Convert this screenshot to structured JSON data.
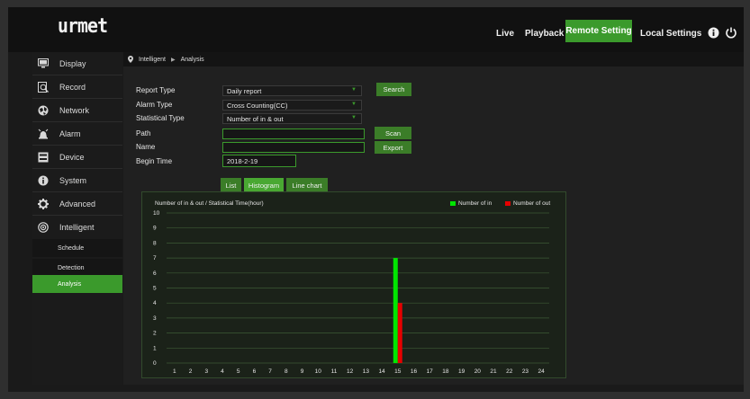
{
  "header": {
    "logo": "urmet",
    "nav": [
      {
        "label": "Live",
        "active": false
      },
      {
        "label": "Playback",
        "active": false
      },
      {
        "label": "Remote Setting",
        "active": true
      },
      {
        "label": "Local Settings",
        "active": false
      }
    ],
    "icons": [
      "info-icon",
      "power-icon"
    ]
  },
  "sidebar": {
    "items": [
      {
        "label": "Display",
        "icon": "monitor-icon"
      },
      {
        "label": "Record",
        "icon": "record-icon"
      },
      {
        "label": "Network",
        "icon": "network-icon"
      },
      {
        "label": "Alarm",
        "icon": "alarm-icon"
      },
      {
        "label": "Device",
        "icon": "device-icon"
      },
      {
        "label": "System",
        "icon": "system-info-icon"
      },
      {
        "label": "Advanced",
        "icon": "gear-icon"
      },
      {
        "label": "Intelligent",
        "icon": "intelligent-icon"
      }
    ],
    "subitems": [
      {
        "label": "Schedule",
        "active": false
      },
      {
        "label": "Detection",
        "active": false
      },
      {
        "label": "Analysis",
        "active": true
      }
    ]
  },
  "breadcrumb": {
    "section": "Intelligent",
    "page": "Analysis"
  },
  "form": {
    "report_type_label": "Report Type",
    "report_type_value": "Daily report",
    "alarm_type_label": "Alarm Type",
    "alarm_type_value": "Cross Counting(CC)",
    "statistical_type_label": "Statistical Type",
    "statistical_type_value": "Number of in & out",
    "path_label": "Path",
    "path_value": "",
    "name_label": "Name",
    "name_value": "",
    "begin_time_label": "Begin Time",
    "begin_time_value": "2018-2-19",
    "search_button": "Search",
    "scan_button": "Scan",
    "export_button": "Export"
  },
  "view_tabs": [
    {
      "label": "List",
      "active": false
    },
    {
      "label": "Histogram",
      "active": true
    },
    {
      "label": "Line chart",
      "active": false
    }
  ],
  "colors": {
    "accent": "#3b9a2c",
    "series_in": "#00e600",
    "series_out": "#e60000"
  },
  "chart_data": {
    "type": "bar",
    "title": "Number of in & out / Statistical Time(hour)",
    "xlabel": "",
    "ylabel": "",
    "categories": [
      "1",
      "2",
      "3",
      "4",
      "5",
      "6",
      "7",
      "8",
      "9",
      "10",
      "11",
      "12",
      "13",
      "14",
      "15",
      "16",
      "17",
      "18",
      "19",
      "20",
      "21",
      "22",
      "23",
      "24"
    ],
    "ylim": [
      0,
      10
    ],
    "yticks": [
      "0",
      "1",
      "2",
      "3",
      "4",
      "5",
      "6",
      "7",
      "8",
      "9",
      "10"
    ],
    "grid": true,
    "legend_position": "top-right",
    "series": [
      {
        "name": "Number of in",
        "color": "#00e600",
        "values": [
          0,
          0,
          0,
          0,
          0,
          0,
          0,
          0,
          0,
          0,
          0,
          0,
          0,
          0,
          7,
          0,
          0,
          0,
          0,
          0,
          0,
          0,
          0,
          0
        ]
      },
      {
        "name": "Number of out",
        "color": "#e60000",
        "values": [
          0,
          0,
          0,
          0,
          0,
          0,
          0,
          0,
          0,
          0,
          0,
          0,
          0,
          0,
          4,
          0,
          0,
          0,
          0,
          0,
          0,
          0,
          0,
          0
        ]
      }
    ]
  }
}
